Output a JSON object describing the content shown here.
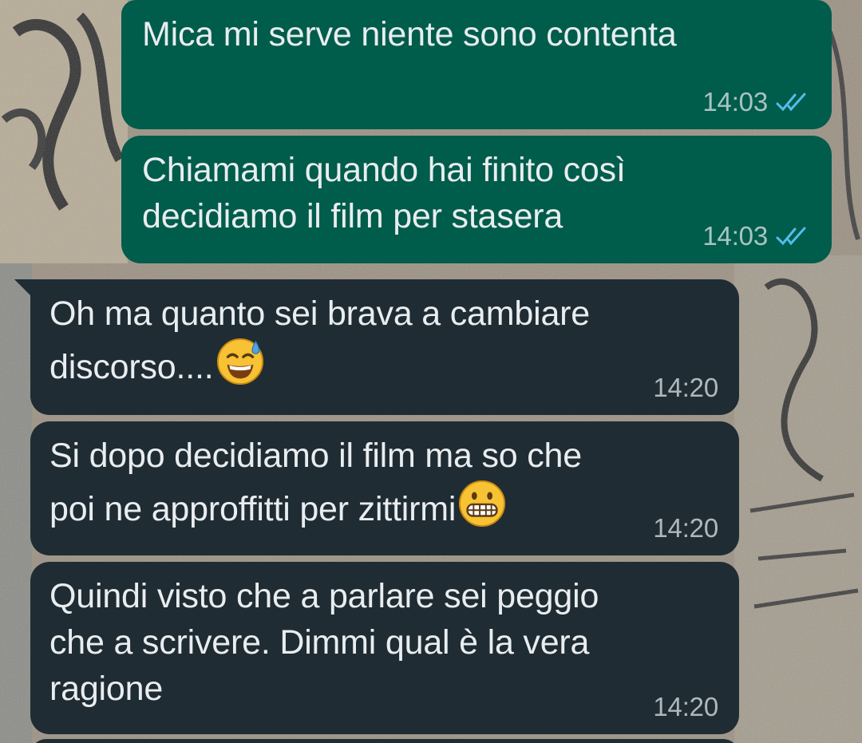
{
  "chat": {
    "messages": [
      {
        "direction": "out",
        "text": "Mica mi serve niente sono contenta",
        "time": "14:03",
        "status": "read"
      },
      {
        "direction": "out",
        "text": "Chiamami quando hai finito così\ndecidiamo il film per stasera",
        "time": "14:03",
        "status": "read"
      },
      {
        "direction": "in",
        "text": "Oh ma quanto sei brava a cambiare\ndiscorso....",
        "emoji": "sweat-smile-emoji",
        "time": "14:20"
      },
      {
        "direction": "in",
        "text": "Si dopo decidiamo il film ma so che\npoi ne approffitti per zittirmi",
        "emoji": "grimacing-emoji",
        "time": "14:20"
      },
      {
        "direction": "in",
        "text": "Quindi visto che a parlare sei peggio\nche a scrivere. Dimmi qual è la vera\nragione",
        "time": "14:20"
      }
    ]
  },
  "colors": {
    "outgoing_bubble": "#005c4b",
    "incoming_bubble": "#1f2c34",
    "read_ticks": "#53bdeb",
    "text": "#e9edef"
  }
}
